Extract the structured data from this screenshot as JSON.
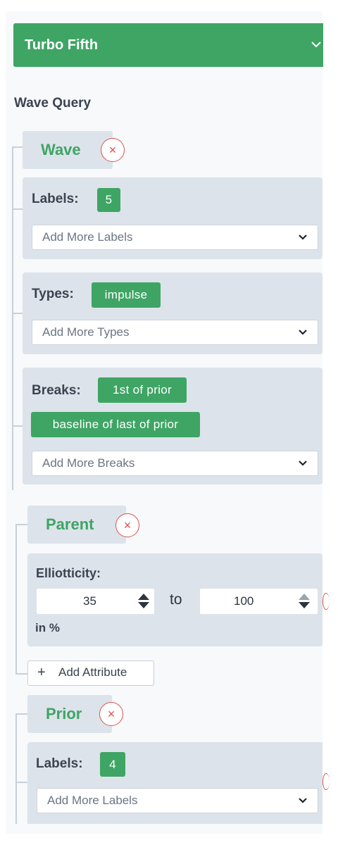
{
  "header": {
    "title": "Turbo Fifth",
    "chevron": "chevron-down-icon"
  },
  "section_title": "Wave Query",
  "wave": {
    "tab_label": "Wave",
    "remove_symbol": "×",
    "labels": {
      "label": "Labels:",
      "tags": [
        "5"
      ],
      "placeholder": "Add More Labels"
    },
    "types": {
      "label": "Types:",
      "tags": [
        "impulse"
      ],
      "placeholder": "Add More Types"
    },
    "breaks": {
      "label": "Breaks:",
      "tags": [
        "1st of prior",
        "baseline of last of prior"
      ],
      "placeholder": "Add More Breaks"
    }
  },
  "parent": {
    "tab_label": "Parent",
    "remove_symbol": "×",
    "attribute": {
      "label": "Elliotticity:",
      "min_value": "35",
      "range_word": "to",
      "max_value": "100",
      "unit": "in %"
    },
    "add_attribute": {
      "icon_symbol": "+",
      "label": "Add Attribute"
    }
  },
  "prior": {
    "tab_label": "Prior",
    "remove_symbol": "×",
    "labels": {
      "label": "Labels:",
      "tags": [
        "4"
      ],
      "placeholder": "Add More Labels"
    }
  },
  "colors": {
    "accent": "#3ea564",
    "danger": "#d9534f",
    "panel": "#dde3ea"
  }
}
